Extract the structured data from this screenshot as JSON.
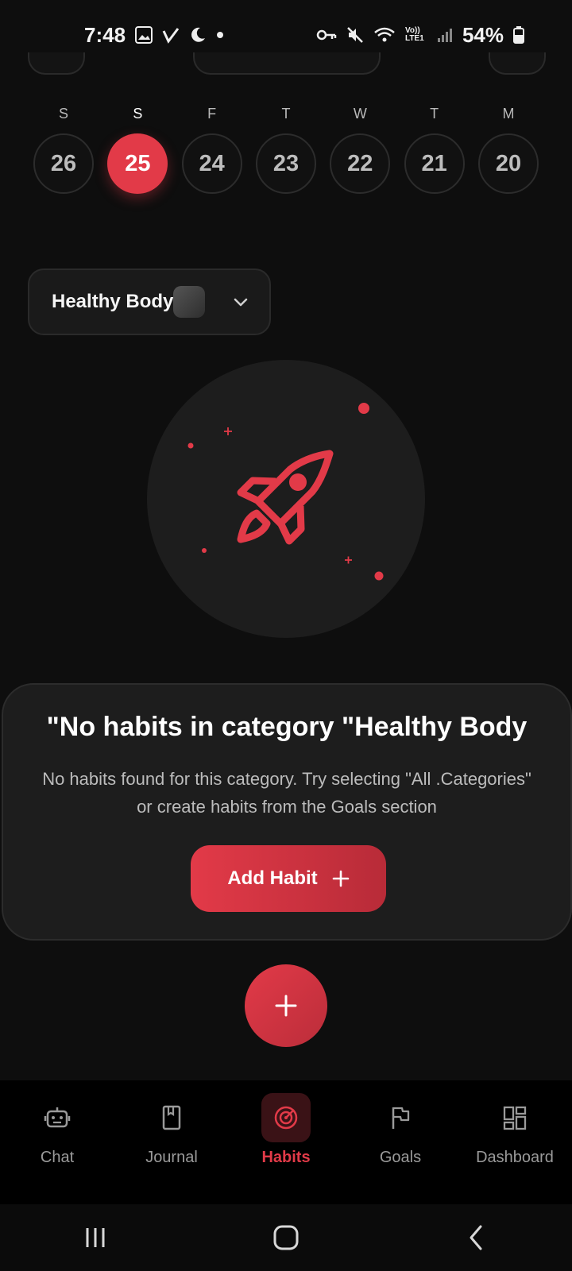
{
  "status_bar": {
    "time": "7:48",
    "battery": "54%",
    "network": "Vo)) LTE1"
  },
  "calendar": {
    "days": [
      {
        "letter": "S",
        "number": "26",
        "active": false
      },
      {
        "letter": "S",
        "number": "25",
        "active": true
      },
      {
        "letter": "F",
        "number": "24",
        "active": false
      },
      {
        "letter": "T",
        "number": "23",
        "active": false
      },
      {
        "letter": "W",
        "number": "22",
        "active": false
      },
      {
        "letter": "T",
        "number": "21",
        "active": false
      },
      {
        "letter": "M",
        "number": "20",
        "active": false
      }
    ]
  },
  "category_selector": {
    "label": "Healthy Body"
  },
  "empty_state": {
    "title": "\"No habits in category \"Healthy Body",
    "description": "No habits found for this category. Try selecting \"All .Categories\" or create habits from the Goals section",
    "button_label": "Add Habit",
    "button_icon": "plus-icon"
  },
  "bottom_nav": {
    "items": [
      {
        "label": "Chat",
        "icon": "robot-icon",
        "active": false
      },
      {
        "label": "Journal",
        "icon": "book-icon",
        "active": false
      },
      {
        "label": "Habits",
        "icon": "target-icon",
        "active": true
      },
      {
        "label": "Goals",
        "icon": "flag-icon",
        "active": false
      },
      {
        "label": "Dashboard",
        "icon": "dashboard-icon",
        "active": false
      }
    ]
  },
  "colors": {
    "accent": "#e23a48",
    "background": "#0e0e0e",
    "card": "#1d1d1d"
  }
}
